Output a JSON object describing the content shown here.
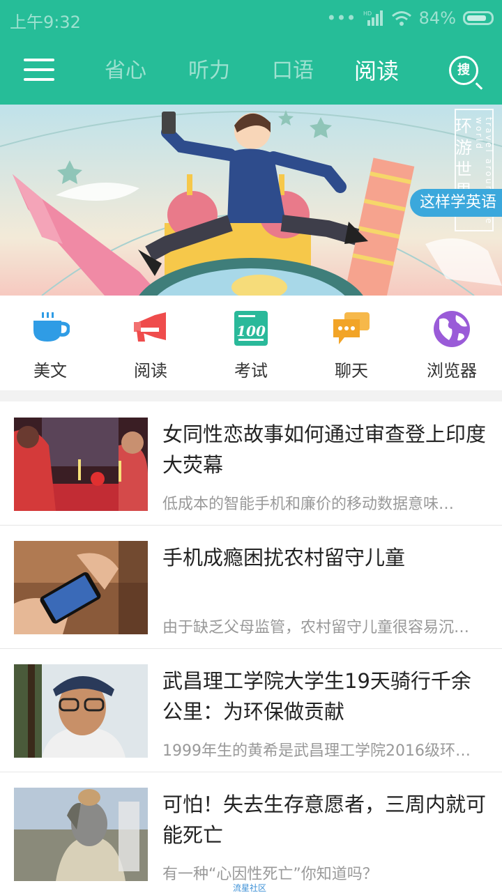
{
  "status_bar": {
    "time": "上午9:32",
    "network": "HD",
    "battery": "84%"
  },
  "header": {
    "tabs": [
      "省心",
      "听力",
      "口语",
      "阅读"
    ],
    "active_tab": "阅读",
    "search_label": "搜"
  },
  "banner": {
    "tag": "这样学英语",
    "vertical_text": "环游世界",
    "small_text": "travel around the world",
    "active_dot": 0
  },
  "categories": [
    {
      "label": "美文",
      "icon": "coffee-cup-icon",
      "color": "#2f9ce5"
    },
    {
      "label": "阅读",
      "icon": "megaphone-icon",
      "color": "#ef4c4c"
    },
    {
      "label": "考试",
      "icon": "exam-100-icon",
      "color": "#2ab99a"
    },
    {
      "label": "聊天",
      "icon": "chat-bubbles-icon",
      "color": "#f2a427"
    },
    {
      "label": "浏览器",
      "icon": "globe-icon",
      "color": "#9a5bd8"
    }
  ],
  "articles": [
    {
      "title": "女同性恋故事如何通过审查登上印度大荧幕",
      "summary": "低成本的智能手机和廉价的移动数据意味…"
    },
    {
      "title": "手机成瘾困扰农村留守儿童",
      "summary": "由于缺乏父母监管，农村留守儿童很容易沉…"
    },
    {
      "title": "武昌理工学院大学生19天骑行千余公里：为环保做贡献",
      "summary": "1999年生的黄希是武昌理工学院2016级环…"
    },
    {
      "title": "可怕！失去生存意愿者，三周内就可能死亡",
      "summary": "有一种“心因性死亡”你知道吗？"
    }
  ],
  "footer": {
    "watermark": "流星社区"
  },
  "colors": {
    "brand": "#26bd98"
  }
}
